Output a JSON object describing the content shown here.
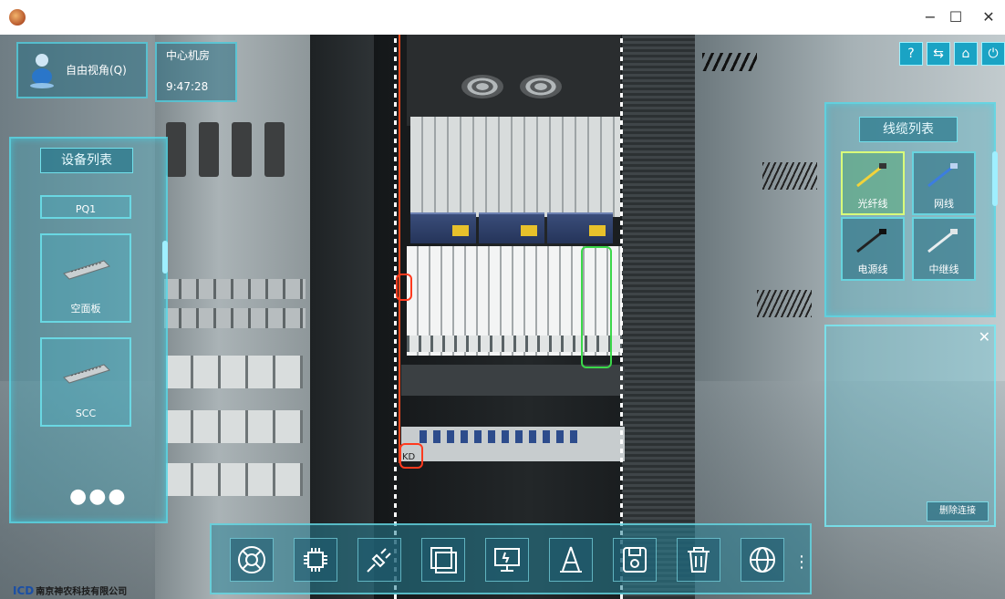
{
  "window": {
    "minimize_glyph": "−",
    "maximize_glyph": "☐",
    "close_glyph": "✕"
  },
  "view_mode": {
    "label": "自由视角(Q)"
  },
  "location_panel": {
    "room": "中心机房",
    "time": "9:47:28"
  },
  "device_list": {
    "title": "设备列表",
    "items": [
      {
        "label": "PQ1"
      },
      {
        "label": "空面板"
      },
      {
        "label": "SCC"
      }
    ],
    "more_glyph": "●●●"
  },
  "cable_list": {
    "title": "线缆列表",
    "items": [
      {
        "label": "光纤线",
        "selected": true,
        "color": "#f2d33a"
      },
      {
        "label": "网线",
        "selected": false,
        "color": "#3c7de0"
      },
      {
        "label": "电源线",
        "selected": false,
        "color": "#222222"
      },
      {
        "label": "中继线",
        "selected": false,
        "color": "#e8eef0"
      }
    ]
  },
  "connection_panel": {
    "close_glyph": "✕",
    "delete_label": "删除连接"
  },
  "system_buttons": [
    {
      "glyph": "?"
    },
    {
      "glyph": "⇆"
    },
    {
      "glyph": "⌂"
    },
    {
      "glyph": "⏻"
    }
  ],
  "toolbar": {
    "tools": [
      {
        "icon": "lifebuoy-icon"
      },
      {
        "icon": "chip-icon"
      },
      {
        "icon": "plug-icon"
      },
      {
        "icon": "panel-icon"
      },
      {
        "icon": "monitor-icon"
      },
      {
        "icon": "cone-icon"
      },
      {
        "icon": "save-icon"
      },
      {
        "icon": "trash-icon"
      },
      {
        "icon": "globe-icon"
      }
    ],
    "more_glyph": "⋮"
  },
  "rack": {
    "kd_label": "KD"
  },
  "logo": {
    "mark": "ICD",
    "text": "南京神农科技有限公司"
  },
  "colors": {
    "hud_accent": "#5adceb",
    "highlight_green": "#3bd84a",
    "cable_red": "#ff4a1f"
  }
}
